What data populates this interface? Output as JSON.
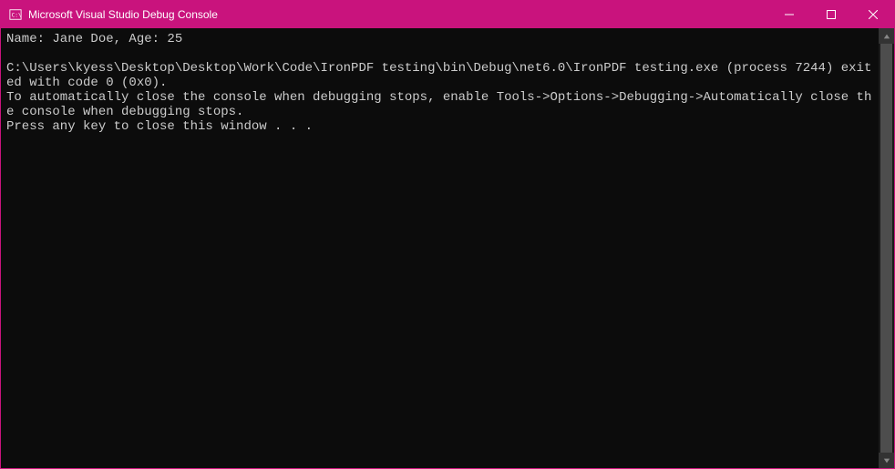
{
  "window": {
    "title": "Microsoft Visual Studio Debug Console"
  },
  "console": {
    "lines": [
      "Name: Jane Doe, Age: 25",
      "",
      "C:\\Users\\kyess\\Desktop\\Desktop\\Work\\Code\\IronPDF testing\\bin\\Debug\\net6.0\\IronPDF testing.exe (process 7244) exited with code 0 (0x0).",
      "To automatically close the console when debugging stops, enable Tools->Options->Debugging->Automatically close the console when debugging stops.",
      "Press any key to close this window . . ."
    ]
  }
}
